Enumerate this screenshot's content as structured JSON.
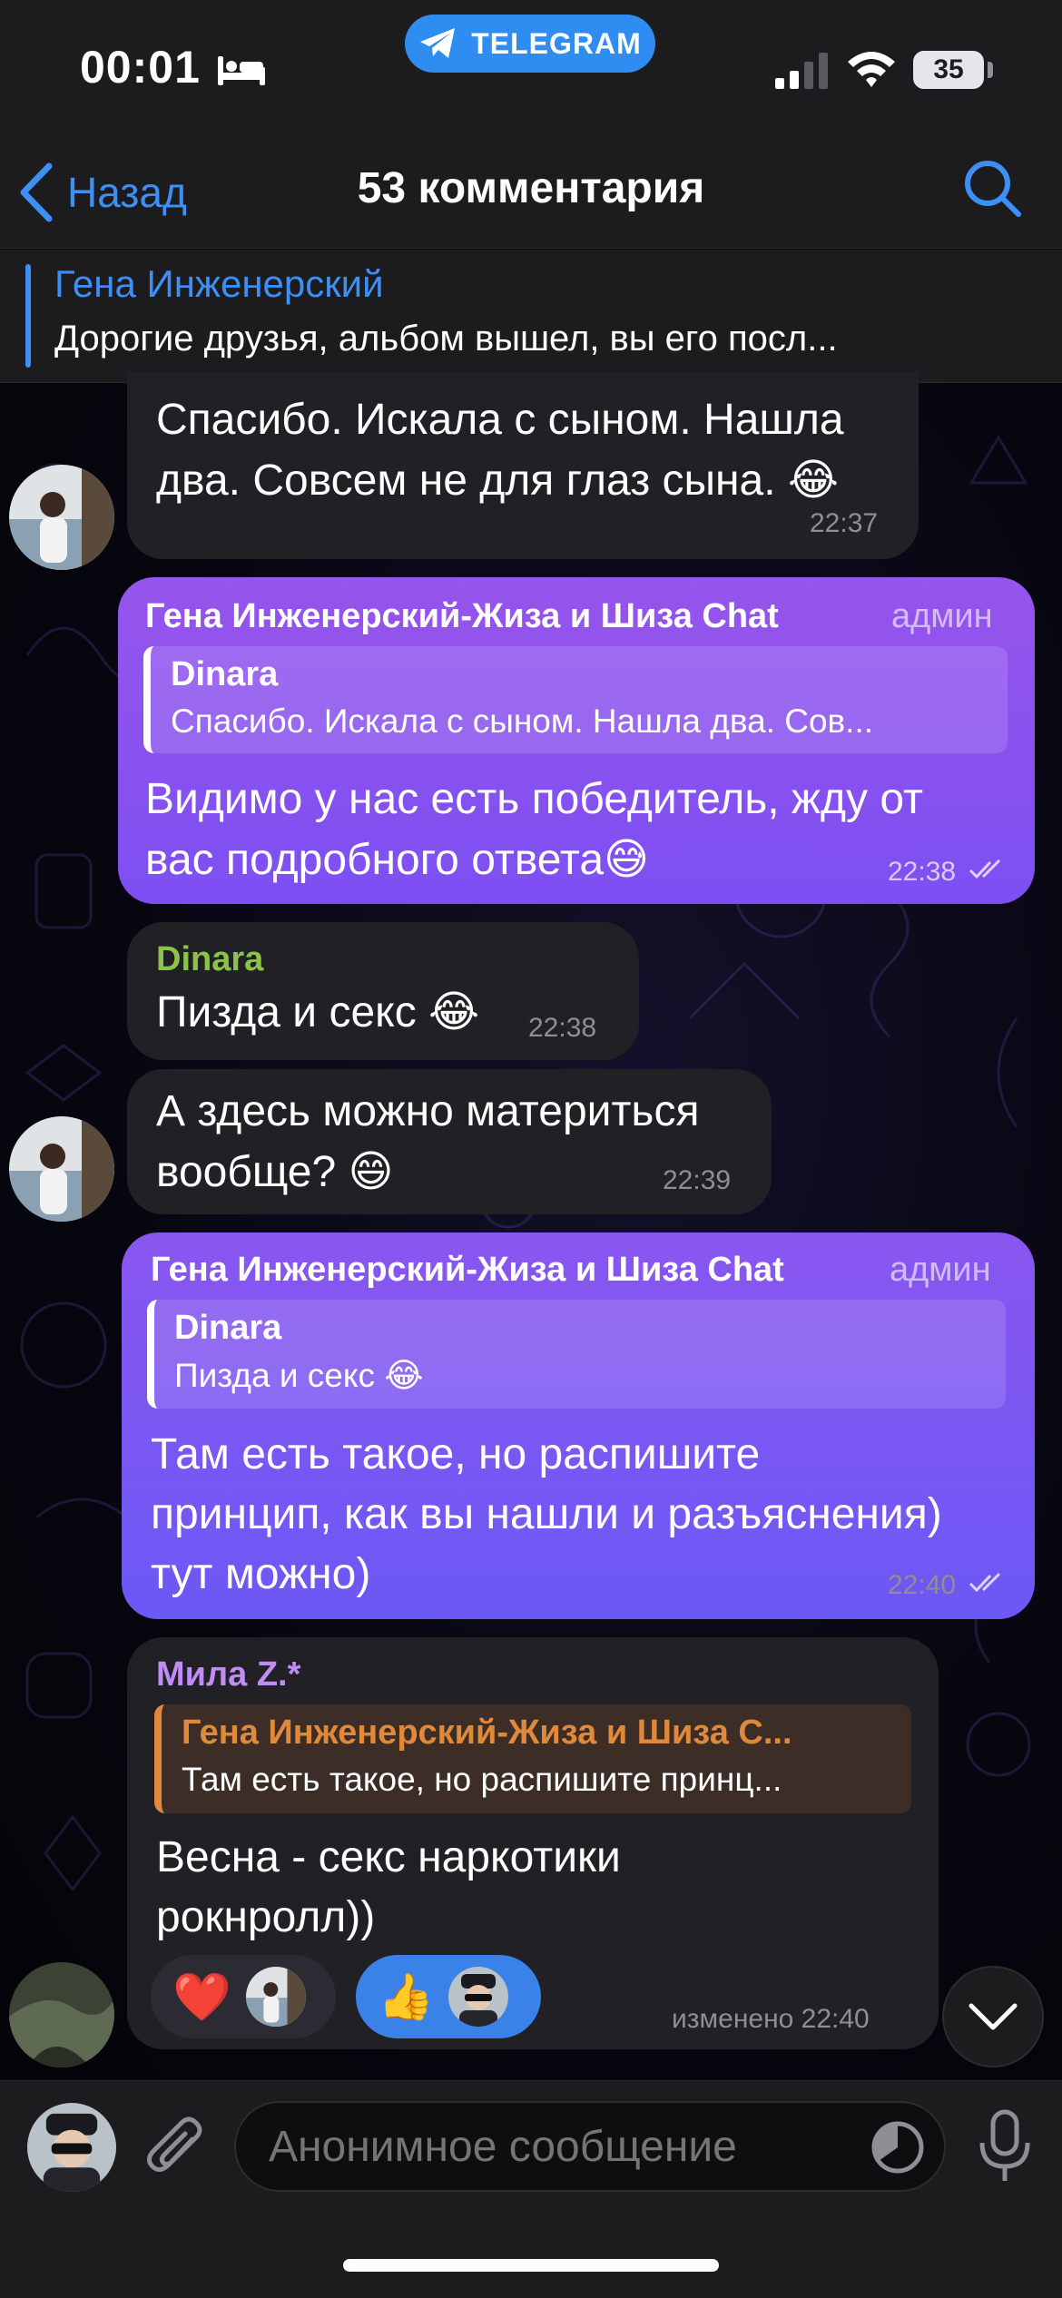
{
  "status_bar": {
    "time": "00:01",
    "app_pill": "TELEGRAM",
    "battery": "35"
  },
  "nav": {
    "back_label": "Назад",
    "title": "53 комментария"
  },
  "pinned": {
    "author": "Гена Инженерский",
    "text": "Дорогие друзья, альбом вышел, вы его посл..."
  },
  "messages": [
    {
      "text_line1": "Спасибо. Искала с сыном. Нашла",
      "text_line2": "два. Совсем не для глаз сына.",
      "emoji": "😂",
      "time": "22:37"
    },
    {
      "sender": "Гена Инженерский-Жиза и Шиза Chat",
      "admin": "админ",
      "quote_name": "Dinara",
      "quote_text": "Спасибо. Искала с сыном. Нашла два. Сов...",
      "text_line1": "Видимо у нас есть победитель, жду от",
      "text_line2": "вас подробного ответа",
      "emoji": "😅",
      "time": "22:38"
    },
    {
      "sender": "Dinara",
      "text": "Пизда и секс",
      "emoji": "😂",
      "time": "22:38"
    },
    {
      "text_line1": "А здесь можно материться",
      "text_line2": "вообще?",
      "emoji": "😄",
      "time": "22:39"
    },
    {
      "sender": "Гена Инженерский-Жиза и Шиза Chat",
      "admin": "админ",
      "quote_name": "Dinara",
      "quote_text": "Пизда и секс",
      "quote_emoji": "😂",
      "text_line1": "Там есть такое, но распишите",
      "text_line2": "принцип, как вы нашли и разъяснения)",
      "text_line3": "тут можно)",
      "time": "22:40"
    },
    {
      "sender": "Мила Z.*",
      "quote_name": "Гена Инженерский-Жиза и Шиза С...",
      "quote_text": "Там есть такое, но распишите принц...",
      "text_line1": "Весна - секс наркотики",
      "text_line2": "рокнролл))",
      "reaction1": "❤️",
      "reaction2": "👍",
      "time": "изменено 22:40"
    }
  ],
  "input": {
    "placeholder": "Анонимное сообщение"
  },
  "colors": {
    "accent": "#3d8ff5",
    "incoming_bubble": "#212025",
    "outgoing_bubble": "#8a56f0",
    "dinara_name": "#8bc34a",
    "mila_name": "#c08df5",
    "quote_orange": "#e0893b"
  }
}
